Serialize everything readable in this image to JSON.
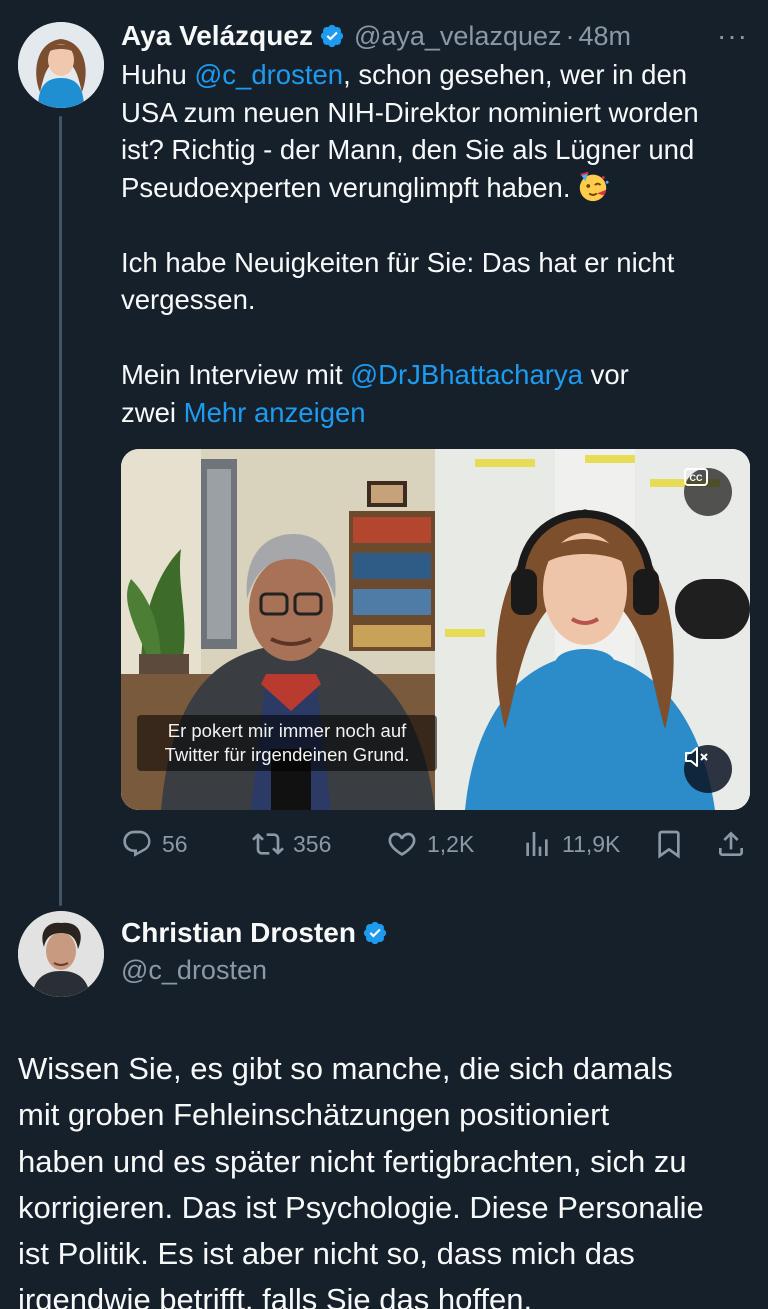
{
  "tweet1": {
    "author_name": "Aya Velázquez",
    "handle": "@aya_velazquez",
    "separator": "·",
    "time": "48m",
    "more": "···",
    "lines": [
      {
        "pre": "Huhu ",
        "mention": "@c_drosten",
        "post": ", schon gesehen, wer in den"
      },
      {
        "text": "USA zum neuen NIH-Direktor nominiert worden"
      },
      {
        "text": "ist? Richtig - der Mann, den Sie als Lügner und"
      },
      {
        "text": "Pseudoexperten verunglimpft haben."
      },
      {
        "text": "Ich habe Neuigkeiten für Sie: Das hat er nicht"
      },
      {
        "text": "vergessen."
      },
      {
        "pre": "Mein Interview mit ",
        "mention": "@DrJBhattacharya",
        "post": " vor"
      },
      {
        "pre": "zwei ",
        "link": "Mehr anzeigen"
      }
    ],
    "video": {
      "subtitle_line1": "Er pokert mir immer noch auf",
      "subtitle_line2": "Twitter für irgendeinen Grund.",
      "cc_label": "CC"
    },
    "stats": {
      "replies": "56",
      "retweets": "356",
      "likes": "1,2K",
      "views": "11,9K"
    }
  },
  "tweet2": {
    "author_name": "Christian Drosten",
    "handle": "@c_drosten",
    "lines": [
      "Wissen Sie, es gibt so manche, die sich damals",
      "mit groben Fehleinschätzungen positioniert",
      "haben und es später nicht fertigbrachten, sich zu",
      "korrigieren. Das ist Psychologie. Diese Personalie",
      "ist Politik. Es ist aber nicht so, dass mich das",
      "irgendwie betrifft, falls Sie das hoffen."
    ]
  },
  "colors": {
    "background": "#15202b",
    "text": "#f7f9f9",
    "secondary": "#8b98a5",
    "link": "#1d9bf0",
    "verified": "#1d9bf0"
  },
  "icons": {
    "verified": "verified-badge-icon",
    "emoji": "partying-face-emoji",
    "reply": "reply-icon",
    "retweet": "retweet-icon",
    "like": "heart-icon",
    "views": "views-bar-chart-icon",
    "bookmark": "bookmark-icon",
    "share": "share-icon",
    "mute": "muted-speaker-icon",
    "cc": "closed-captions-icon"
  }
}
